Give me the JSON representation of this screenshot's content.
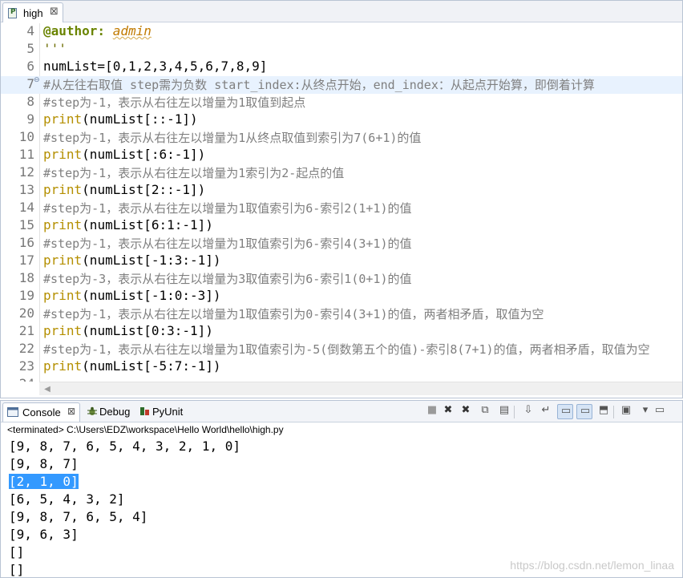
{
  "editor": {
    "tab": {
      "label": "high",
      "close": "⊠",
      "icon": "python-file-icon"
    },
    "lines": [
      {
        "num": "4",
        "segments": [
          {
            "c": "deco",
            "t": "@author:"
          },
          {
            "c": "ident",
            "t": " "
          },
          {
            "c": "attr",
            "t": "admin"
          }
        ]
      },
      {
        "num": "5",
        "segments": [
          {
            "c": "str",
            "t": "'''"
          }
        ]
      },
      {
        "num": "6",
        "segments": [
          {
            "c": "ident",
            "t": "numList=[0,1,2,3,4,5,6,7,8,9]"
          }
        ]
      },
      {
        "num": "7",
        "current": true,
        "fold": true,
        "segments": [
          {
            "c": "cm",
            "t": "#从左往右取值 step需为负数 start_index:从终点开始，end_index：从起点开始算，即倒着计算"
          }
        ]
      },
      {
        "num": "8",
        "segments": [
          {
            "c": "cm",
            "t": "#step为-1，表示从右往左以增量为1取值到起点"
          }
        ]
      },
      {
        "num": "9",
        "segments": [
          {
            "c": "builtin",
            "t": "print"
          },
          {
            "c": "paren",
            "t": "(numList[::-1])"
          }
        ]
      },
      {
        "num": "10",
        "segments": [
          {
            "c": "cm",
            "t": "#step为-1，表示从右往左以增量为1从终点取值到索引为7(6+1)的值"
          }
        ]
      },
      {
        "num": "11",
        "segments": [
          {
            "c": "builtin",
            "t": "print"
          },
          {
            "c": "paren",
            "t": "(numList[:6:-1])"
          }
        ]
      },
      {
        "num": "12",
        "segments": [
          {
            "c": "cm",
            "t": "#step为-1，表示从右往左以增量为1索引为2-起点的值"
          }
        ]
      },
      {
        "num": "13",
        "segments": [
          {
            "c": "builtin",
            "t": "print"
          },
          {
            "c": "paren",
            "t": "(numList[2::-1])"
          }
        ]
      },
      {
        "num": "14",
        "segments": [
          {
            "c": "cm",
            "t": "#step为-1，表示从右往左以增量为1取值索引为6-索引2(1+1)的值"
          }
        ]
      },
      {
        "num": "15",
        "segments": [
          {
            "c": "builtin",
            "t": "print"
          },
          {
            "c": "paren",
            "t": "(numList[6:1:-1])"
          }
        ]
      },
      {
        "num": "16",
        "segments": [
          {
            "c": "cm",
            "t": "#step为-1，表示从右往左以增量为1取值索引为6-索引4(3+1)的值"
          }
        ]
      },
      {
        "num": "17",
        "segments": [
          {
            "c": "builtin",
            "t": "print"
          },
          {
            "c": "paren",
            "t": "(numList[-1:3:-1])"
          }
        ]
      },
      {
        "num": "18",
        "segments": [
          {
            "c": "cm",
            "t": "#step为-3，表示从右往左以增量为3取值索引为6-索引1(0+1)的值"
          }
        ]
      },
      {
        "num": "19",
        "segments": [
          {
            "c": "builtin",
            "t": "print"
          },
          {
            "c": "paren",
            "t": "(numList[-1:0:-3])"
          }
        ]
      },
      {
        "num": "20",
        "segments": [
          {
            "c": "cm",
            "t": "#step为-1，表示从右往左以增量为1取值索引为0-索引4(3+1)的值，两者相矛盾，取值为空"
          }
        ]
      },
      {
        "num": "21",
        "segments": [
          {
            "c": "builtin",
            "t": "print"
          },
          {
            "c": "paren",
            "t": "(numList[0:3:-1])"
          }
        ]
      },
      {
        "num": "22",
        "segments": [
          {
            "c": "cm",
            "t": "#step为-1，表示从右往左以增量为1取值索引为-5(倒数第五个的值)-索引8(7+1)的值，两者相矛盾，取值为空"
          }
        ]
      },
      {
        "num": "23",
        "segments": [
          {
            "c": "builtin",
            "t": "print"
          },
          {
            "c": "paren",
            "t": "(numList[-5:7:-1])"
          }
        ]
      },
      {
        "num": "24",
        "segments": []
      }
    ]
  },
  "console": {
    "tabs": [
      {
        "label": "Console",
        "icon": "console-icon",
        "close": "⊠",
        "active": true
      },
      {
        "label": "Debug",
        "icon": "debug-bug-icon",
        "active": false
      },
      {
        "label": "PyUnit",
        "icon": "pyunit-icon",
        "active": false
      }
    ],
    "toolbar": [
      {
        "name": "terminate-icon",
        "glyph": "■"
      },
      {
        "name": "remove-launch-icon",
        "glyph": "✖"
      },
      {
        "name": "remove-all-terminated-icon",
        "glyph": "✖"
      },
      {
        "name": "relaunch-icon",
        "glyph": "⧉"
      },
      {
        "name": "clear-console-icon",
        "glyph": "▤"
      },
      {
        "name": "scroll-lock-icon",
        "glyph": "⇩"
      },
      {
        "name": "word-wrap-icon",
        "glyph": "↵"
      },
      {
        "name": "show-console-on-stdout-icon",
        "glyph": "▭",
        "pressed": true
      },
      {
        "name": "show-console-on-stderr-icon",
        "glyph": "▭",
        "pressed": true
      },
      {
        "name": "pin-console-icon",
        "glyph": "⬒"
      },
      {
        "name": "display-selected-console-icon",
        "glyph": "▣"
      },
      {
        "name": "open-console-icon",
        "glyph": "▾"
      },
      {
        "name": "view-menu-icon",
        "glyph": "▭"
      }
    ],
    "status": "<terminated> C:\\Users\\EDZ\\workspace\\Hello World\\hello\\high.py",
    "output": [
      {
        "text": "[9, 8, 7, 6, 5, 4, 3, 2, 1, 0]"
      },
      {
        "text": "[9, 8, 7]"
      },
      {
        "text": "[2, 1, 0]",
        "selected": true
      },
      {
        "text": "[6, 5, 4, 3, 2]"
      },
      {
        "text": "[9, 8, 7, 6, 5, 4]"
      },
      {
        "text": "[9, 6, 3]"
      },
      {
        "text": "[]"
      },
      {
        "text": "[]"
      }
    ],
    "watermark": "https://blog.csdn.net/lemon_linaa"
  },
  "colors": {
    "current_line": "#e8f2fe",
    "selection": "#3399ff",
    "comment": "#7f7f7f",
    "builtin": "#b48f00",
    "decorator": "#6a8400"
  }
}
